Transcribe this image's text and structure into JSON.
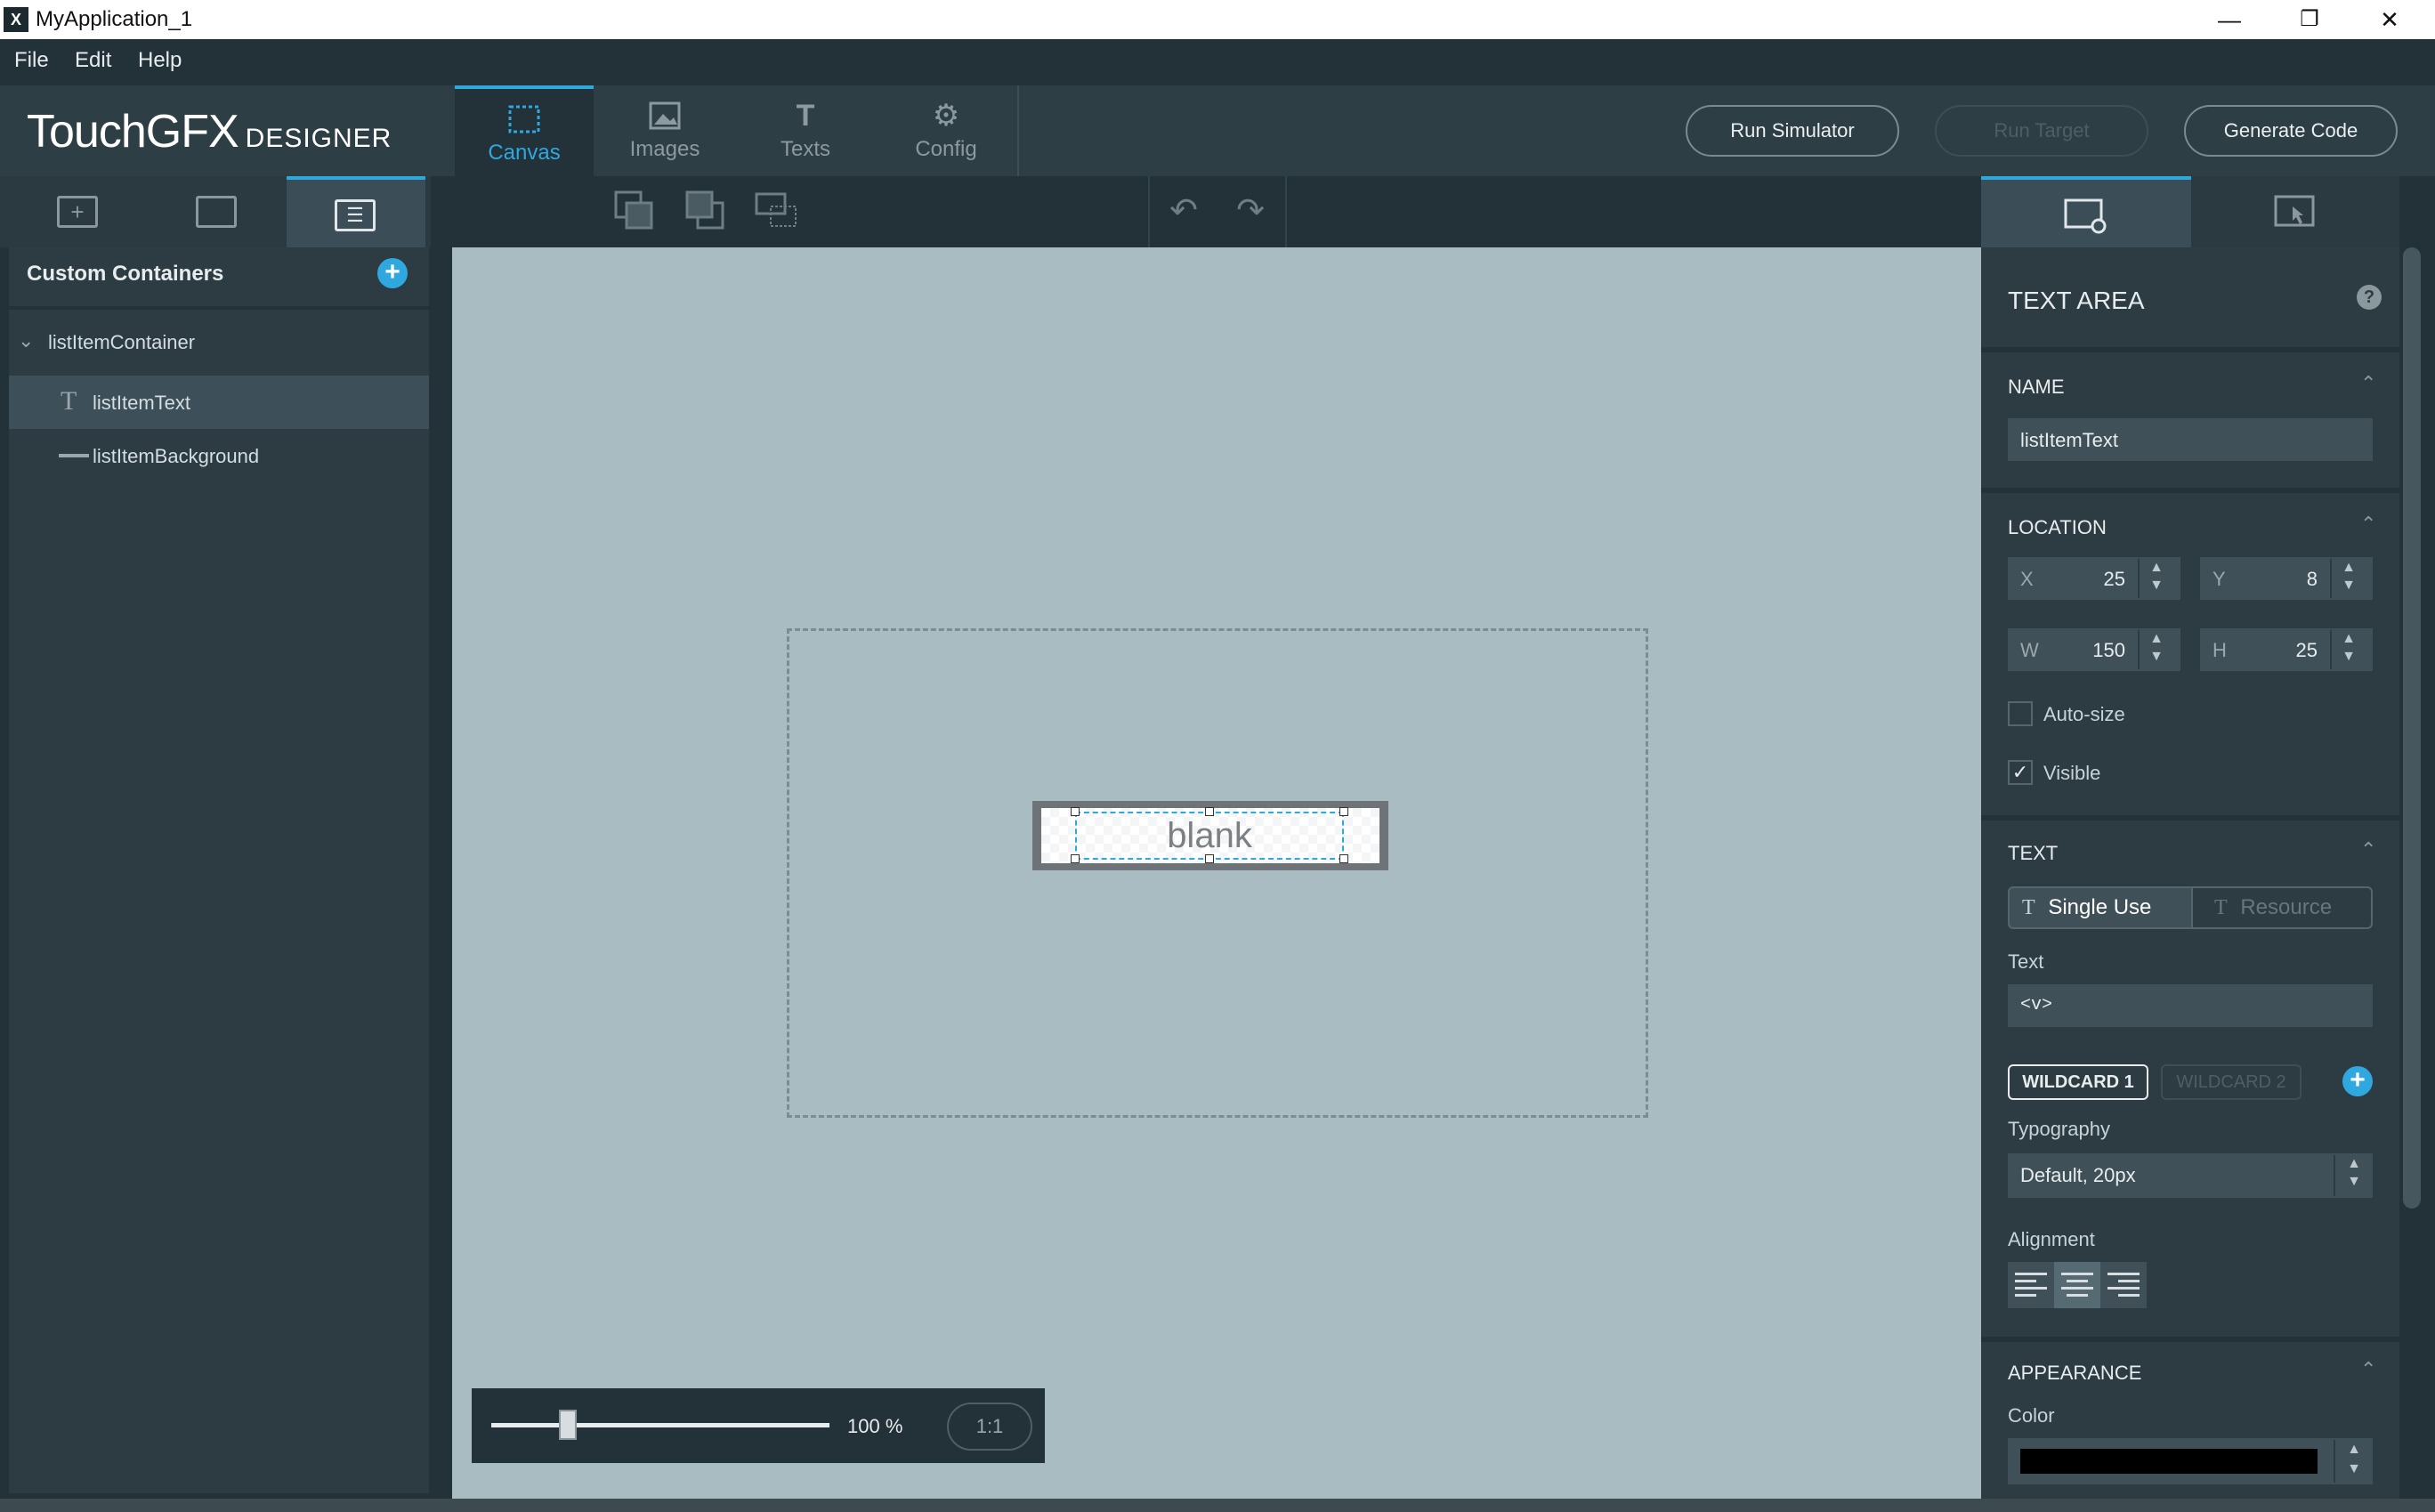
{
  "window": {
    "title": "MyApplication_1",
    "app_icon": "X",
    "controls": [
      "minimize-icon",
      "restore-icon",
      "close-icon"
    ]
  },
  "menu": {
    "file": "File",
    "edit": "Edit",
    "help": "Help"
  },
  "brand": {
    "logo": "TouchGFX",
    "logo_sub": "DESIGNER"
  },
  "tabs": [
    {
      "label": "Canvas",
      "icon": "canvas-icon",
      "active": true
    },
    {
      "label": "Images",
      "icon": "images-icon",
      "active": false
    },
    {
      "label": "Texts",
      "icon": "texts-icon",
      "active": false
    },
    {
      "label": "Config",
      "icon": "config-icon",
      "active": false
    }
  ],
  "header_buttons": {
    "run_simulator": "Run Simulator",
    "run_target": "Run Target",
    "generate_code": "Generate Code"
  },
  "left_panel": {
    "section_title": "Custom Containers",
    "tree": [
      {
        "label": "listItemContainer",
        "icon": "chevron-down-icon"
      },
      {
        "label": "listItemText",
        "icon": "text-t-icon",
        "selected": true
      },
      {
        "label": "listItemBackground",
        "icon": "line-icon"
      }
    ]
  },
  "canvas": {
    "widget_text": "blank"
  },
  "zoom": {
    "value": "100 %",
    "reset": "1:1",
    "level_percent": 100
  },
  "properties": {
    "title": "TEXT AREA",
    "name_section": "NAME",
    "name_value": "listItemText",
    "location_section": "LOCATION",
    "x_label": "X",
    "x_value": "25",
    "y_label": "Y",
    "y_value": "8",
    "w_label": "W",
    "w_value": "150",
    "h_label": "H",
    "h_value": "25",
    "autosize_label": "Auto-size",
    "autosize_checked": false,
    "visible_label": "Visible",
    "visible_checked": true,
    "text_section": "TEXT",
    "single_use": "Single Use",
    "resource": "Resource",
    "text_label": "Text",
    "text_value": "<v>",
    "wildcard1": "WILDCARD 1",
    "wildcard2": "WILDCARD 2",
    "typography_label": "Typography",
    "typography_value": "Default,  20px",
    "alignment_label": "Alignment",
    "appearance_section": "APPEARANCE",
    "color_label": "Color",
    "color_value": "#000000"
  },
  "colors": {
    "accent": "#2fa8e0",
    "canvas_bg": "#a9bcc2",
    "panel_bg": "#2d3c43"
  }
}
